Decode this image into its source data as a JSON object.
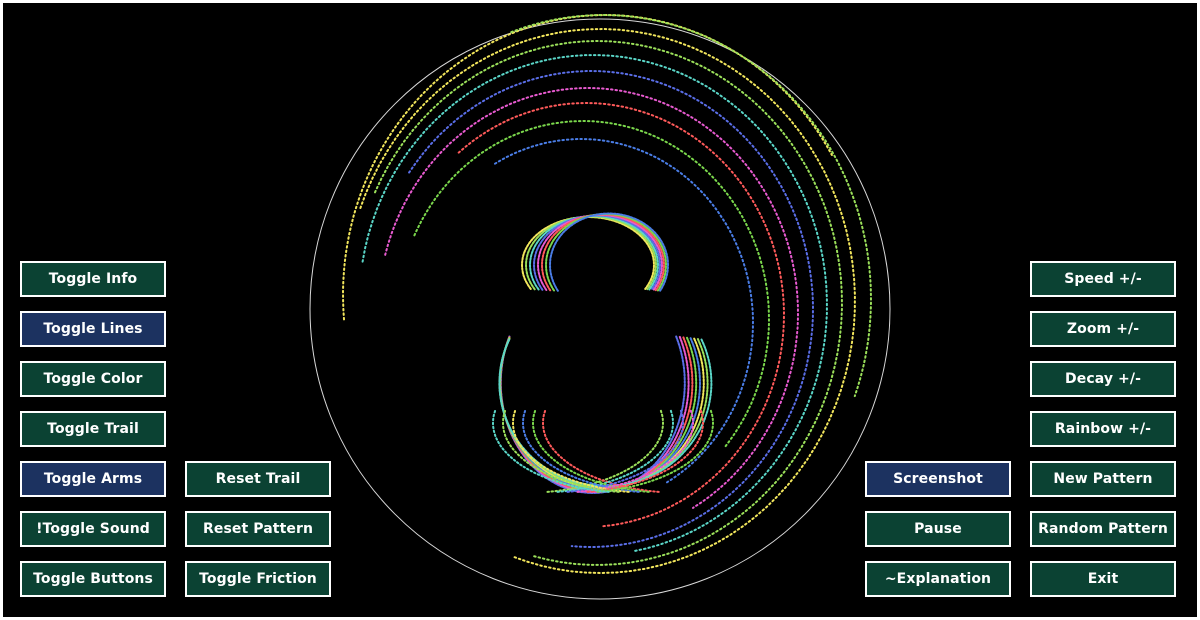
{
  "colors": {
    "background": "#000000",
    "button_green": "#0b4233",
    "button_blue": "#1c3260",
    "button_border": "#ffffff",
    "circle": "#ffffff",
    "trail_palette": [
      "#f2e65c",
      "#9be05a",
      "#5ad6c8",
      "#5a6ee8",
      "#e85ad0",
      "#ff5a5a",
      "#7bd84c",
      "#4a7de6"
    ]
  },
  "left_buttons": [
    {
      "label": "Toggle Info",
      "state": "green"
    },
    {
      "label": "Toggle Lines",
      "state": "blue"
    },
    {
      "label": "Toggle Color",
      "state": "green"
    },
    {
      "label": "Toggle Trail",
      "state": "green"
    },
    {
      "label": "Toggle Arms",
      "state": "blue"
    },
    {
      "label": "!Toggle Sound",
      "state": "green"
    },
    {
      "label": "Toggle Buttons",
      "state": "green"
    }
  ],
  "left_secondary_buttons": [
    {
      "label": "Reset Trail",
      "state": "green"
    },
    {
      "label": "Reset Pattern",
      "state": "green"
    },
    {
      "label": "Toggle Friction",
      "state": "green"
    }
  ],
  "right_secondary_buttons": [
    {
      "label": "Screenshot",
      "state": "blue"
    },
    {
      "label": "Pause",
      "state": "green"
    },
    {
      "label": "~Explanation",
      "state": "green"
    }
  ],
  "right_buttons": [
    {
      "label": "Speed +/-",
      "state": "green"
    },
    {
      "label": "Zoom +/-",
      "state": "green"
    },
    {
      "label": "Decay +/-",
      "state": "green"
    },
    {
      "label": "Rainbow +/-",
      "state": "green"
    },
    {
      "label": "New Pattern",
      "state": "green"
    },
    {
      "label": "Random Pattern",
      "state": "green"
    },
    {
      "label": "Exit",
      "state": "green"
    }
  ]
}
